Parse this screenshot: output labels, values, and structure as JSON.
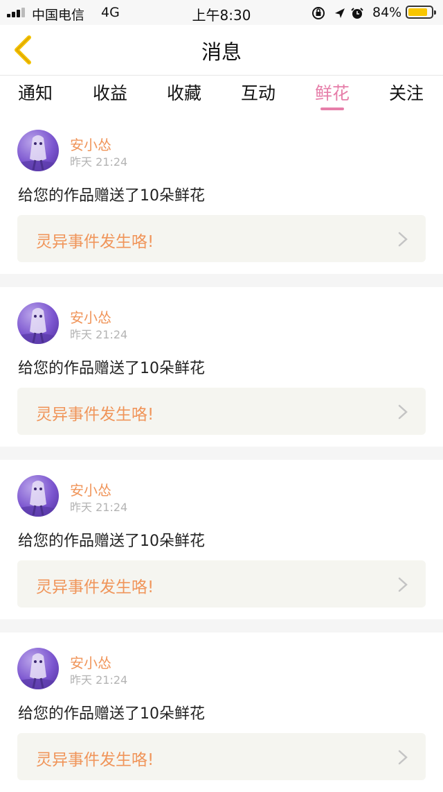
{
  "status_bar": {
    "carrier": "中国电信",
    "network": "4G",
    "time": "上午8:30",
    "battery_text": "84%",
    "battery_level": 0.84,
    "icons": [
      "rotation-lock-icon",
      "location-icon",
      "alarm-icon"
    ],
    "battery_color": "#f8c600"
  },
  "header": {
    "title": "消息",
    "back_icon": "chevron-left-icon",
    "back_color": "#f3c200"
  },
  "tabs": [
    {
      "label": "通知",
      "active": false
    },
    {
      "label": "收益",
      "active": false
    },
    {
      "label": "收藏",
      "active": false
    },
    {
      "label": "互动",
      "active": false
    },
    {
      "label": "鲜花",
      "active": true
    },
    {
      "label": "关注",
      "active": false
    }
  ],
  "colors": {
    "accent_pink": "#e67ea9",
    "name_orange": "#f0955a",
    "card_bg": "#f5f5f0",
    "separator": "#f5f5f5"
  },
  "messages": [
    {
      "name": "安小怂",
      "time": "昨天 21:24",
      "text": "给您的作品赠送了10朵鲜花",
      "work_title": "灵异事件发生咯!"
    },
    {
      "name": "安小怂",
      "time": "昨天 21:24",
      "text": "给您的作品赠送了10朵鲜花",
      "work_title": "灵异事件发生咯!"
    },
    {
      "name": "安小怂",
      "time": "昨天 21:24",
      "text": "给您的作品赠送了10朵鲜花",
      "work_title": "灵异事件发生咯!"
    },
    {
      "name": "安小怂",
      "time": "昨天 21:24",
      "text": "给您的作品赠送了10朵鲜花",
      "work_title": "灵异事件发生咯!"
    }
  ]
}
